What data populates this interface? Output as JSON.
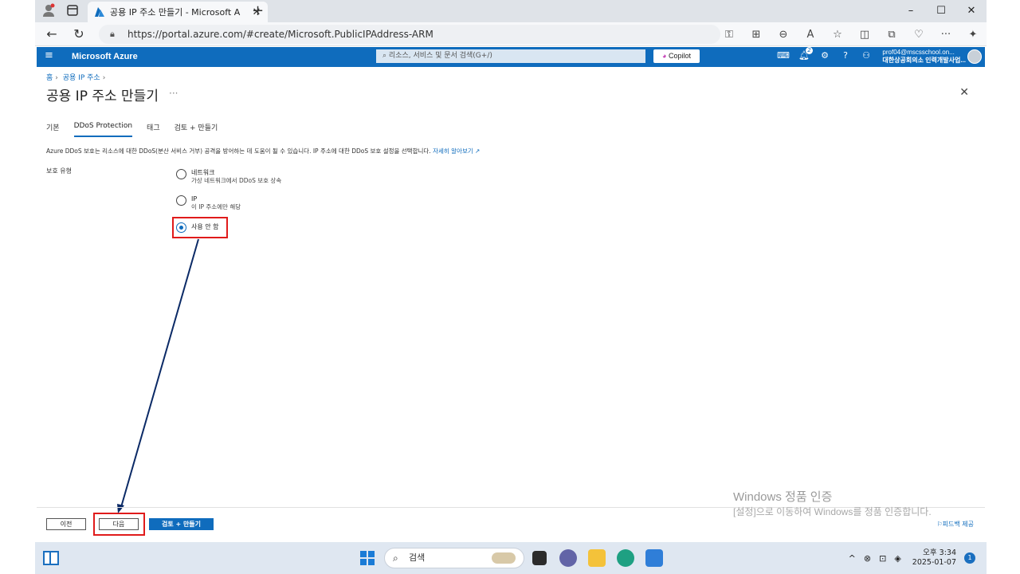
{
  "browser": {
    "tab_title": "공용 IP 주소 만들기 - Microsoft A",
    "new_tab": "+",
    "url": "https://portal.azure.com/#create/Microsoft.PublicIPAddress-ARM",
    "window_controls": [
      "–",
      "☐",
      "✕"
    ]
  },
  "azure": {
    "brand": "Microsoft Azure",
    "search_placeholder": "리소스, 서비스 및 문서 검색(G+/)",
    "copilot_label": "Copilot",
    "notification_count": "2",
    "account_email": "prof04@mscsschool.on...",
    "account_org": "대한상공회의소 인력개발사업..."
  },
  "breadcrumb": {
    "home": "홈",
    "parent": "공용 IP 주소"
  },
  "page": {
    "title": "공용 IP 주소 만들기",
    "ellipsis": "···"
  },
  "tabs": [
    {
      "label": "기본"
    },
    {
      "label": "DDoS Protection",
      "active": true
    },
    {
      "label": "태그"
    },
    {
      "label": "검토 + 만들기"
    }
  ],
  "description": {
    "text": "Azure DDoS 보호는 리소스에 대한 DDoS(분산 서비스 거부) 공격을 방어하는 데 도움이 될 수 있습니다. IP 주소에 대한 DDoS 보호 설정을 선택합니다.",
    "link": "자세히 알아보기"
  },
  "protection": {
    "label": "보호 유형",
    "options": [
      {
        "label": "네트워크",
        "sub": "가상 네트워크에서 DDoS 보호 상속",
        "selected": false
      },
      {
        "label": "IP",
        "sub": "이 IP 주소에만 해당",
        "selected": false
      },
      {
        "label": "사용 안 함",
        "sub": "",
        "selected": true
      }
    ]
  },
  "footer": {
    "prev": "이전",
    "next": "다음",
    "review_create": "검토 + 만들기",
    "feedback": "피드백 제공"
  },
  "watermark": {
    "line1": "Windows 정품 인증",
    "line2": "[설정]으로 이동하여 Windows를 정품 인증합니다."
  },
  "taskbar": {
    "search": "검색",
    "time_period": "오후 3:34",
    "date": "2025-01-07",
    "notification_count": "1"
  },
  "colors": {
    "azure_blue": "#0f6cbd",
    "annotation_red": "#e01b1b",
    "arrow_navy": "#0b2a66"
  }
}
